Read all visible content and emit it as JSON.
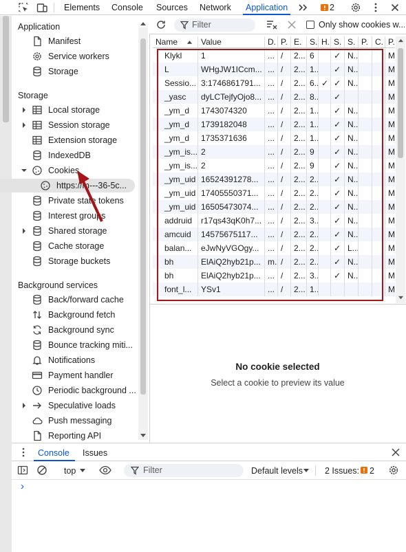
{
  "tabs": {
    "items": [
      "Elements",
      "Console",
      "Sources",
      "Network",
      "Application"
    ],
    "active": "Application",
    "issues_count": "2"
  },
  "sidebar": {
    "application_header": "Application",
    "application_items": [
      "Manifest",
      "Service workers",
      "Storage"
    ],
    "storage_header": "Storage",
    "storage_items": [
      "Local storage",
      "Session storage",
      "Extension storage",
      "IndexedDB",
      "Cookies",
      "https://m---36-5c...",
      "Private state tokens",
      "Interest groups",
      "Shared storage",
      "Cache storage",
      "Storage buckets"
    ],
    "background_header": "Background services",
    "background_items": [
      "Back/forward cache",
      "Background fetch",
      "Background sync",
      "Bounce tracking miti...",
      "Notifications",
      "Payment handler",
      "Periodic background ...",
      "Speculative loads",
      "Push messaging",
      "Reporting API"
    ]
  },
  "cookie_toolbar": {
    "filter_placeholder": "Filter",
    "only_issues_label": "Only show cookies w..."
  },
  "cookie_table": {
    "columns": [
      "Name",
      "Value",
      "D.",
      "P.",
      "E.",
      "S.",
      "H.",
      "S.",
      "S.",
      "P.",
      "C.",
      "P."
    ],
    "rows": [
      {
        "name": "Klykl",
        "value": "1",
        "d": "...",
        "p": "/",
        "e": "2...",
        "s": "6",
        "h": "",
        "s2": "✓",
        "s3": "N...",
        "p2": "",
        "c": "",
        "p3": "M"
      },
      {
        "name": "L",
        "value": "WHgJW1ICcm...",
        "d": "...",
        "p": "/",
        "e": "2...",
        "s": "1...",
        "h": "",
        "s2": "✓",
        "s3": "N...",
        "p2": "",
        "c": "",
        "p3": "M"
      },
      {
        "name": "Sessio...",
        "value": "3:1746861791...",
        "d": "...",
        "p": "/",
        "e": "2...",
        "s": "6...",
        "h": "✓",
        "s2": "✓",
        "s3": "N...",
        "p2": "",
        "c": "",
        "p3": "M"
      },
      {
        "name": "_yasc",
        "value": "dyLCTejfyOjo8...",
        "d": "...",
        "p": "/",
        "e": "2...",
        "s": "8...",
        "h": "",
        "s2": "✓",
        "s3": "",
        "p2": "",
        "c": "",
        "p3": "M"
      },
      {
        "name": "_ym_d",
        "value": "1743074320",
        "d": "...",
        "p": "/",
        "e": "2...",
        "s": "1...",
        "h": "",
        "s2": "✓",
        "s3": "N...",
        "p2": "",
        "c": "",
        "p3": "M"
      },
      {
        "name": "_ym_d",
        "value": "1739182048",
        "d": "...",
        "p": "/",
        "e": "2...",
        "s": "1...",
        "h": "",
        "s2": "✓",
        "s3": "N...",
        "p2": "",
        "c": "",
        "p3": "M"
      },
      {
        "name": "_ym_d",
        "value": "1735371636",
        "d": "...",
        "p": "/",
        "e": "2...",
        "s": "1...",
        "h": "",
        "s2": "✓",
        "s3": "N...",
        "p2": "",
        "c": "",
        "p3": "M"
      },
      {
        "name": "_ym_is...",
        "value": "2",
        "d": "...",
        "p": "/",
        "e": "2...",
        "s": "9",
        "h": "",
        "s2": "✓",
        "s3": "N...",
        "p2": "",
        "c": "",
        "p3": "M"
      },
      {
        "name": "_ym_is...",
        "value": "2",
        "d": "...",
        "p": "/",
        "e": "2...",
        "s": "9",
        "h": "",
        "s2": "✓",
        "s3": "N...",
        "p2": "",
        "c": "",
        "p3": "M"
      },
      {
        "name": "_ym_uid",
        "value": "16524391278...",
        "d": "...",
        "p": "/",
        "e": "2...",
        "s": "2...",
        "h": "",
        "s2": "✓",
        "s3": "N...",
        "p2": "",
        "c": "",
        "p3": "M"
      },
      {
        "name": "_ym_uid",
        "value": "17405550371...",
        "d": "...",
        "p": "/",
        "e": "2...",
        "s": "2...",
        "h": "",
        "s2": "✓",
        "s3": "N...",
        "p2": "",
        "c": "",
        "p3": "M"
      },
      {
        "name": "_ym_uid",
        "value": "16505473074...",
        "d": "...",
        "p": "/",
        "e": "2...",
        "s": "2...",
        "h": "",
        "s2": "✓",
        "s3": "N...",
        "p2": "",
        "c": "",
        "p3": "M"
      },
      {
        "name": "addruid",
        "value": "r17qs43qK0h7...",
        "d": "...",
        "p": "/",
        "e": "2...",
        "s": "3...",
        "h": "",
        "s2": "✓",
        "s3": "N...",
        "p2": "",
        "c": "",
        "p3": "M"
      },
      {
        "name": "amcuid",
        "value": "14575675117...",
        "d": "...",
        "p": "/",
        "e": "2...",
        "s": "2...",
        "h": "",
        "s2": "✓",
        "s3": "N...",
        "p2": "",
        "c": "",
        "p3": "M"
      },
      {
        "name": "balan...",
        "value": "eJwNyVGOgy...",
        "d": "...",
        "p": "/",
        "e": "2...",
        "s": "2...",
        "h": "",
        "s2": "✓",
        "s3": "L...",
        "p2": "",
        "c": "",
        "p3": "M"
      },
      {
        "name": "bh",
        "value": "ElAiQ2hyb21p...",
        "d": "m...",
        "p": "/",
        "e": "2...",
        "s": "2...",
        "h": "",
        "s2": "✓",
        "s3": "N...",
        "p2": "",
        "c": "",
        "p3": "M"
      },
      {
        "name": "bh",
        "value": "ElAiQ2hyb21p...",
        "d": "...",
        "p": "/",
        "e": "2...",
        "s": "3...",
        "h": "",
        "s2": "✓",
        "s3": "N...",
        "p2": "",
        "c": "",
        "p3": "M"
      },
      {
        "name": "font_l...",
        "value": "YSv1",
        "d": "...",
        "p": "/",
        "e": "2...",
        "s": "1...",
        "h": "",
        "s2": "",
        "s3": "",
        "p2": "",
        "c": "",
        "p3": "M"
      }
    ]
  },
  "empty_state": {
    "title": "No cookie selected",
    "subtitle": "Select a cookie to preview its value"
  },
  "drawer": {
    "tabs": [
      "Console",
      "Issues"
    ],
    "context": "top",
    "filter_placeholder": "Filter",
    "levels": "Default levels",
    "issues_label": "2 Issues:",
    "issues_count": "2",
    "prompt": "›"
  },
  "colors": {
    "accent": "#0b57d0",
    "annotation": "#a4161a",
    "issue_badge": "#e8710a"
  }
}
